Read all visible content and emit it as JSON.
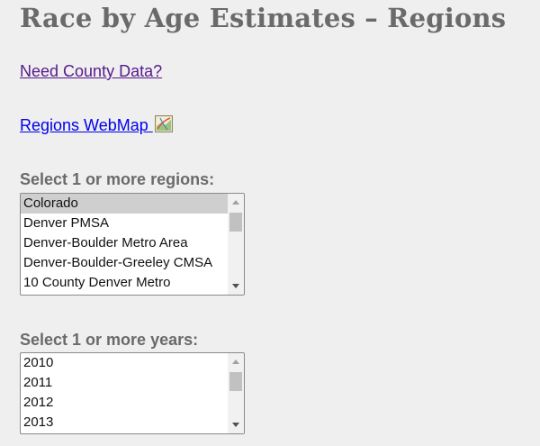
{
  "header": {
    "title": "Race by Age Estimates – Regions"
  },
  "links": {
    "county": "Need County Data?",
    "webmap": "Regions WebMap "
  },
  "icons": {
    "webmap": "map-icon"
  },
  "regions": {
    "label": "Select 1 or more regions:",
    "options": [
      "Colorado",
      "Denver PMSA",
      "Denver-Boulder Metro Area",
      "Denver-Boulder-Greeley CMSA",
      "10 County Denver Metro"
    ],
    "selected": "Colorado"
  },
  "years": {
    "label": "Select 1 or more years:",
    "options": [
      "2010",
      "2011",
      "2012",
      "2013"
    ]
  },
  "colors": {
    "background": "#efefef",
    "heading": "#6a6a6a",
    "visited_link": "#551a8b",
    "link": "#0000ee",
    "selected_option": "#cfcfcf"
  }
}
